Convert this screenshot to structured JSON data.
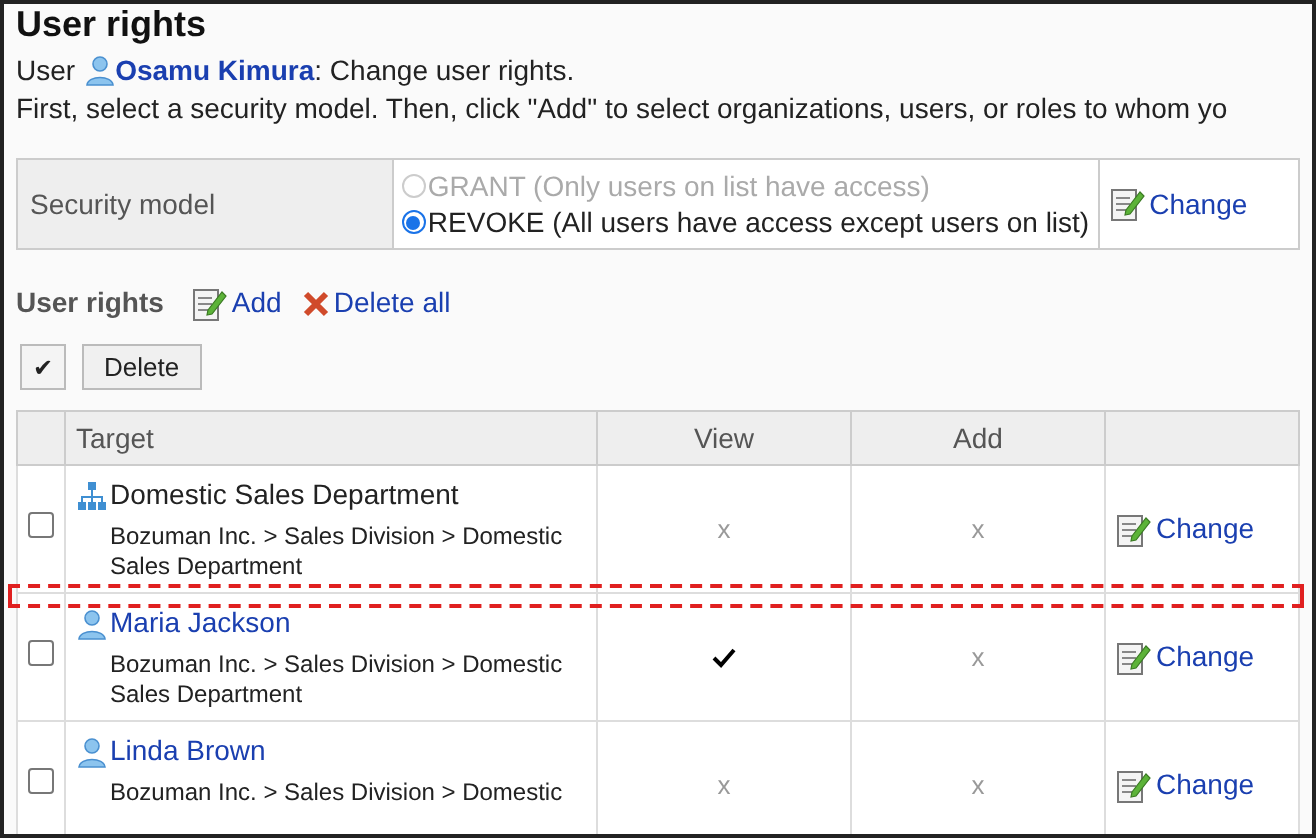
{
  "title": "User rights",
  "intro": {
    "prefix": "User",
    "user": "Osamu Kimura",
    "suffix": ": Change user rights.",
    "instruction": "First, select a security model. Then, click \"Add\" to select organizations, users, or roles to whom yo"
  },
  "security_model": {
    "label": "Security model",
    "options": [
      {
        "label": "GRANT (Only users on list have access)",
        "selected": false,
        "disabled": true
      },
      {
        "label": "REVOKE (All users have access except users on list)",
        "selected": true,
        "disabled": false
      }
    ],
    "action": "Change"
  },
  "user_rights": {
    "heading": "User rights",
    "actions": [
      {
        "kind": "add",
        "label": "Add"
      },
      {
        "kind": "delete",
        "label": "Delete all"
      }
    ],
    "select_all": "✔",
    "delete_button": "Delete"
  },
  "table": {
    "columns": [
      "Target",
      "View",
      "Add"
    ],
    "rows": [
      {
        "kind": "org",
        "name": "Domestic Sales Department",
        "path": "Bozuman Inc. > Sales Division > Domestic Sales Department",
        "checked": false,
        "view": {
          "allowed": false,
          "text": "x"
        },
        "add": {
          "allowed": false,
          "text": "x"
        },
        "action": "Change"
      },
      {
        "kind": "user",
        "name": "Maria Jackson",
        "path": "Bozuman Inc. > Sales Division > Domestic Sales Department",
        "checked": false,
        "view": {
          "allowed": true
        },
        "add": {
          "allowed": false,
          "text": "x"
        },
        "action": "Change"
      },
      {
        "kind": "user",
        "name": "Linda Brown",
        "path": "Bozuman Inc. > Sales Division > Domestic",
        "checked": false,
        "view": {
          "allowed": false,
          "text": "x"
        },
        "add": {
          "allowed": false,
          "text": "x"
        },
        "action": "Change"
      }
    ]
  }
}
